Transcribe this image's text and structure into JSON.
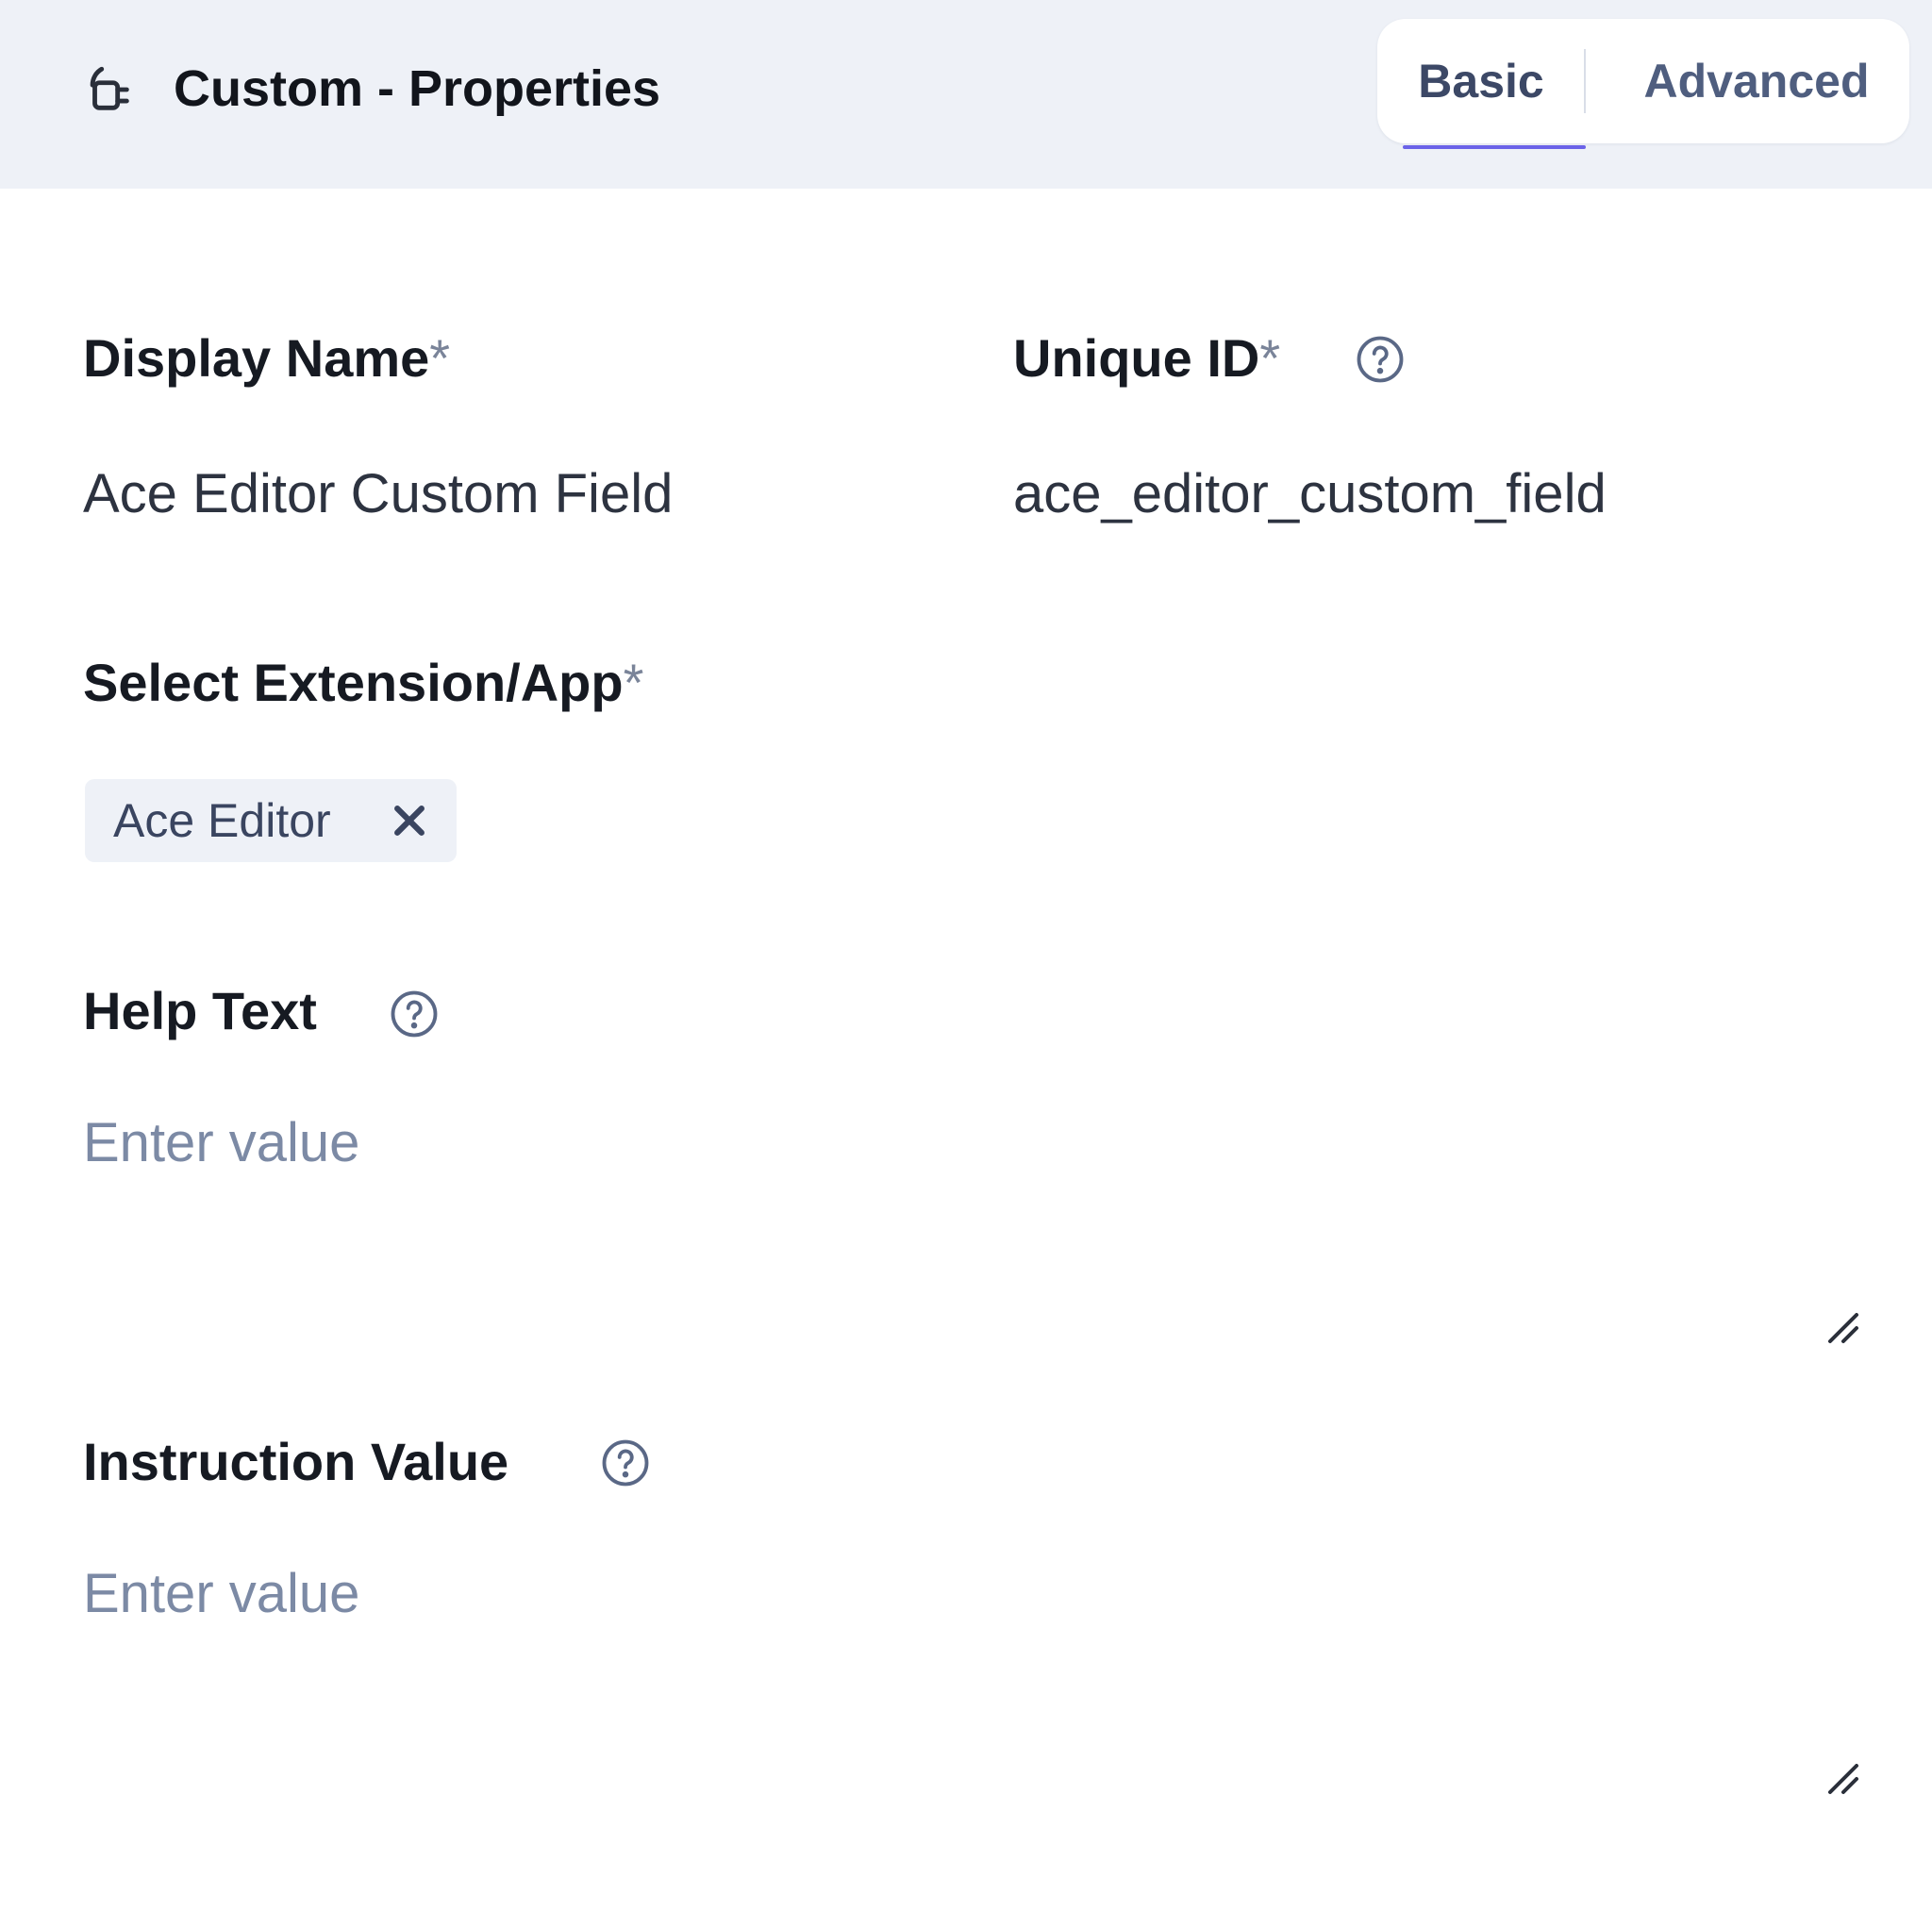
{
  "header": {
    "title": "Custom - Properties",
    "icon": "plug-icon",
    "tabs": [
      {
        "label": "Basic",
        "active": true
      },
      {
        "label": "Advanced",
        "active": false
      }
    ]
  },
  "form": {
    "display_name": {
      "label": "Display Name",
      "required_mark": "*",
      "value": "Ace Editor Custom Field"
    },
    "unique_id": {
      "label": "Unique ID",
      "required_mark": "*",
      "value": "ace_editor_custom_field",
      "help_icon": "question-circle-icon"
    },
    "select_extension": {
      "label": "Select Extension/App",
      "required_mark": "*",
      "selected": [
        {
          "label": "Ace Editor",
          "remove_icon": "close-icon"
        }
      ]
    },
    "help_text": {
      "label": "Help Text",
      "placeholder": "Enter value",
      "help_icon": "question-circle-icon"
    },
    "instruction_value": {
      "label": "Instruction Value",
      "placeholder": "Enter value",
      "help_icon": "question-circle-icon"
    }
  },
  "colors": {
    "header_bg": "#eef1f7",
    "accent": "#6b63e8",
    "label": "#161a22",
    "placeholder": "#7c8aa5",
    "chip_bg": "#eef1f7"
  }
}
